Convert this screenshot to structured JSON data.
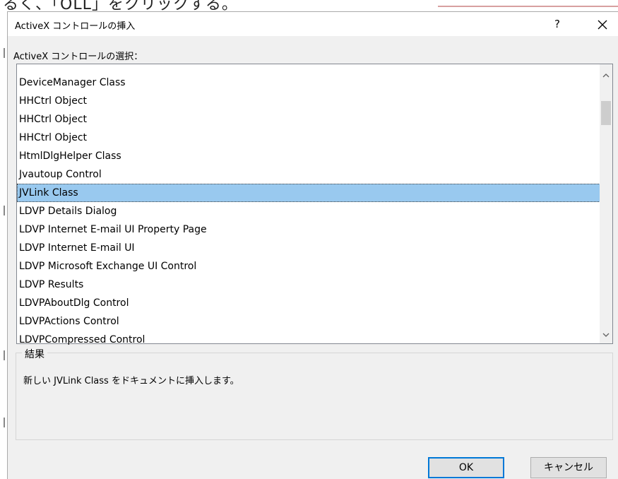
{
  "background_text": "るく、「OLL」をクリックする。",
  "dialog": {
    "title": "ActiveX コントロールの挿入",
    "help_label": "?",
    "close_icon": "close-icon"
  },
  "list": {
    "label": "ActiveX コントロールの選択：",
    "items": [
      "DeviceManager Class",
      "HHCtrl Object",
      "HHCtrl Object",
      "HHCtrl Object",
      "HtmlDlgHelper Class",
      "Jvautoup Control",
      "JVLink Class",
      "LDVP Details Dialog",
      "LDVP Internet E-mail UI Property Page",
      "LDVP Internet E-mail UI",
      "LDVP Microsoft Exchange UI Control",
      "LDVP Results",
      "LDVPAboutDlg Control",
      "LDVPActions Control",
      "LDVPCompressed Control"
    ],
    "selected_index": 6,
    "scroll": {
      "up_icon": "chevron-up-icon",
      "down_icon": "chevron-down-icon"
    }
  },
  "result": {
    "legend": "結果",
    "text": "新しい JVLink Class をドキュメントに挿入します。"
  },
  "buttons": {
    "ok": "OK",
    "cancel": "キャンセル"
  },
  "colors": {
    "selection": "#99c9ef",
    "ok_border": "#0078d7",
    "dialog_bg": "#f0f0f0"
  }
}
